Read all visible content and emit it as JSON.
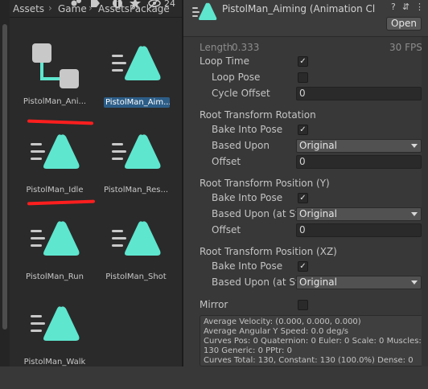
{
  "project": {
    "breadcrumb": [
      "Assets",
      "Game",
      "AssetsPackage"
    ],
    "hidden_count": "24",
    "assets": [
      {
        "name": "PistolMan_AnimController",
        "label": "PistolMan_Ani...",
        "icon": "animator-controller-icon",
        "selected": false
      },
      {
        "name": "PistolMan_Aiming",
        "label": "PistolMan_Aim...",
        "icon": "animation-clip-icon",
        "selected": true
      },
      {
        "name": "PistolMan_Idle",
        "label": "PistolMan_Idle",
        "icon": "animation-clip-icon",
        "selected": false
      },
      {
        "name": "PistolMan_Reset",
        "label": "PistolMan_Res...",
        "icon": "animation-clip-icon",
        "selected": false
      },
      {
        "name": "PistolMan_Run",
        "label": "PistolMan_Run",
        "icon": "animation-clip-icon",
        "selected": false
      },
      {
        "name": "PistolMan_Shot",
        "label": "PistolMan_Shot",
        "icon": "animation-clip-icon",
        "selected": false
      },
      {
        "name": "PistolMan_Walk",
        "label": "PistolMan_Walk",
        "icon": "animation-clip-icon",
        "selected": false
      }
    ],
    "icon_color": "#5ee6cf"
  },
  "inspector": {
    "title": "PistolMan_Aiming (Animation Cli",
    "open_label": "Open",
    "length_label": "Length",
    "length_value": "0.333",
    "fps": "30 FPS",
    "loop_time": {
      "label": "Loop Time",
      "checked": true
    },
    "loop_pose": {
      "label": "Loop Pose",
      "checked": false
    },
    "cycle_offset": {
      "label": "Cycle Offset",
      "value": "0"
    },
    "rotation": {
      "header": "Root Transform Rotation",
      "bake_label": "Bake Into Pose",
      "bake_checked": true,
      "based_label": "Based Upon",
      "based_value": "Original",
      "offset_label": "Offset",
      "offset_value": "0"
    },
    "position_y": {
      "header": "Root Transform Position (Y)",
      "bake_label": "Bake Into Pose",
      "bake_checked": true,
      "based_label": "Based Upon (at St",
      "based_value": "Original",
      "offset_label": "Offset",
      "offset_value": "0"
    },
    "position_xz": {
      "header": "Root Transform Position (XZ)",
      "bake_label": "Bake Into Pose",
      "bake_checked": true,
      "based_label": "Based Upon (at St",
      "based_value": "Original"
    },
    "mirror": {
      "label": "Mirror",
      "checked": false
    },
    "stats": [
      "Average Velocity: (0.000, 0.000, 0.000)",
      "Average Angular Y Speed: 0.0 deg/s",
      "Curves Pos: 0 Quaternion: 0 Euler: 0 Scale: 0 Muscles:",
      "130 Generic: 0 PPtr: 0",
      "Curves Total: 130, Constant: 130 (100.0%) Dense: 0"
    ]
  }
}
